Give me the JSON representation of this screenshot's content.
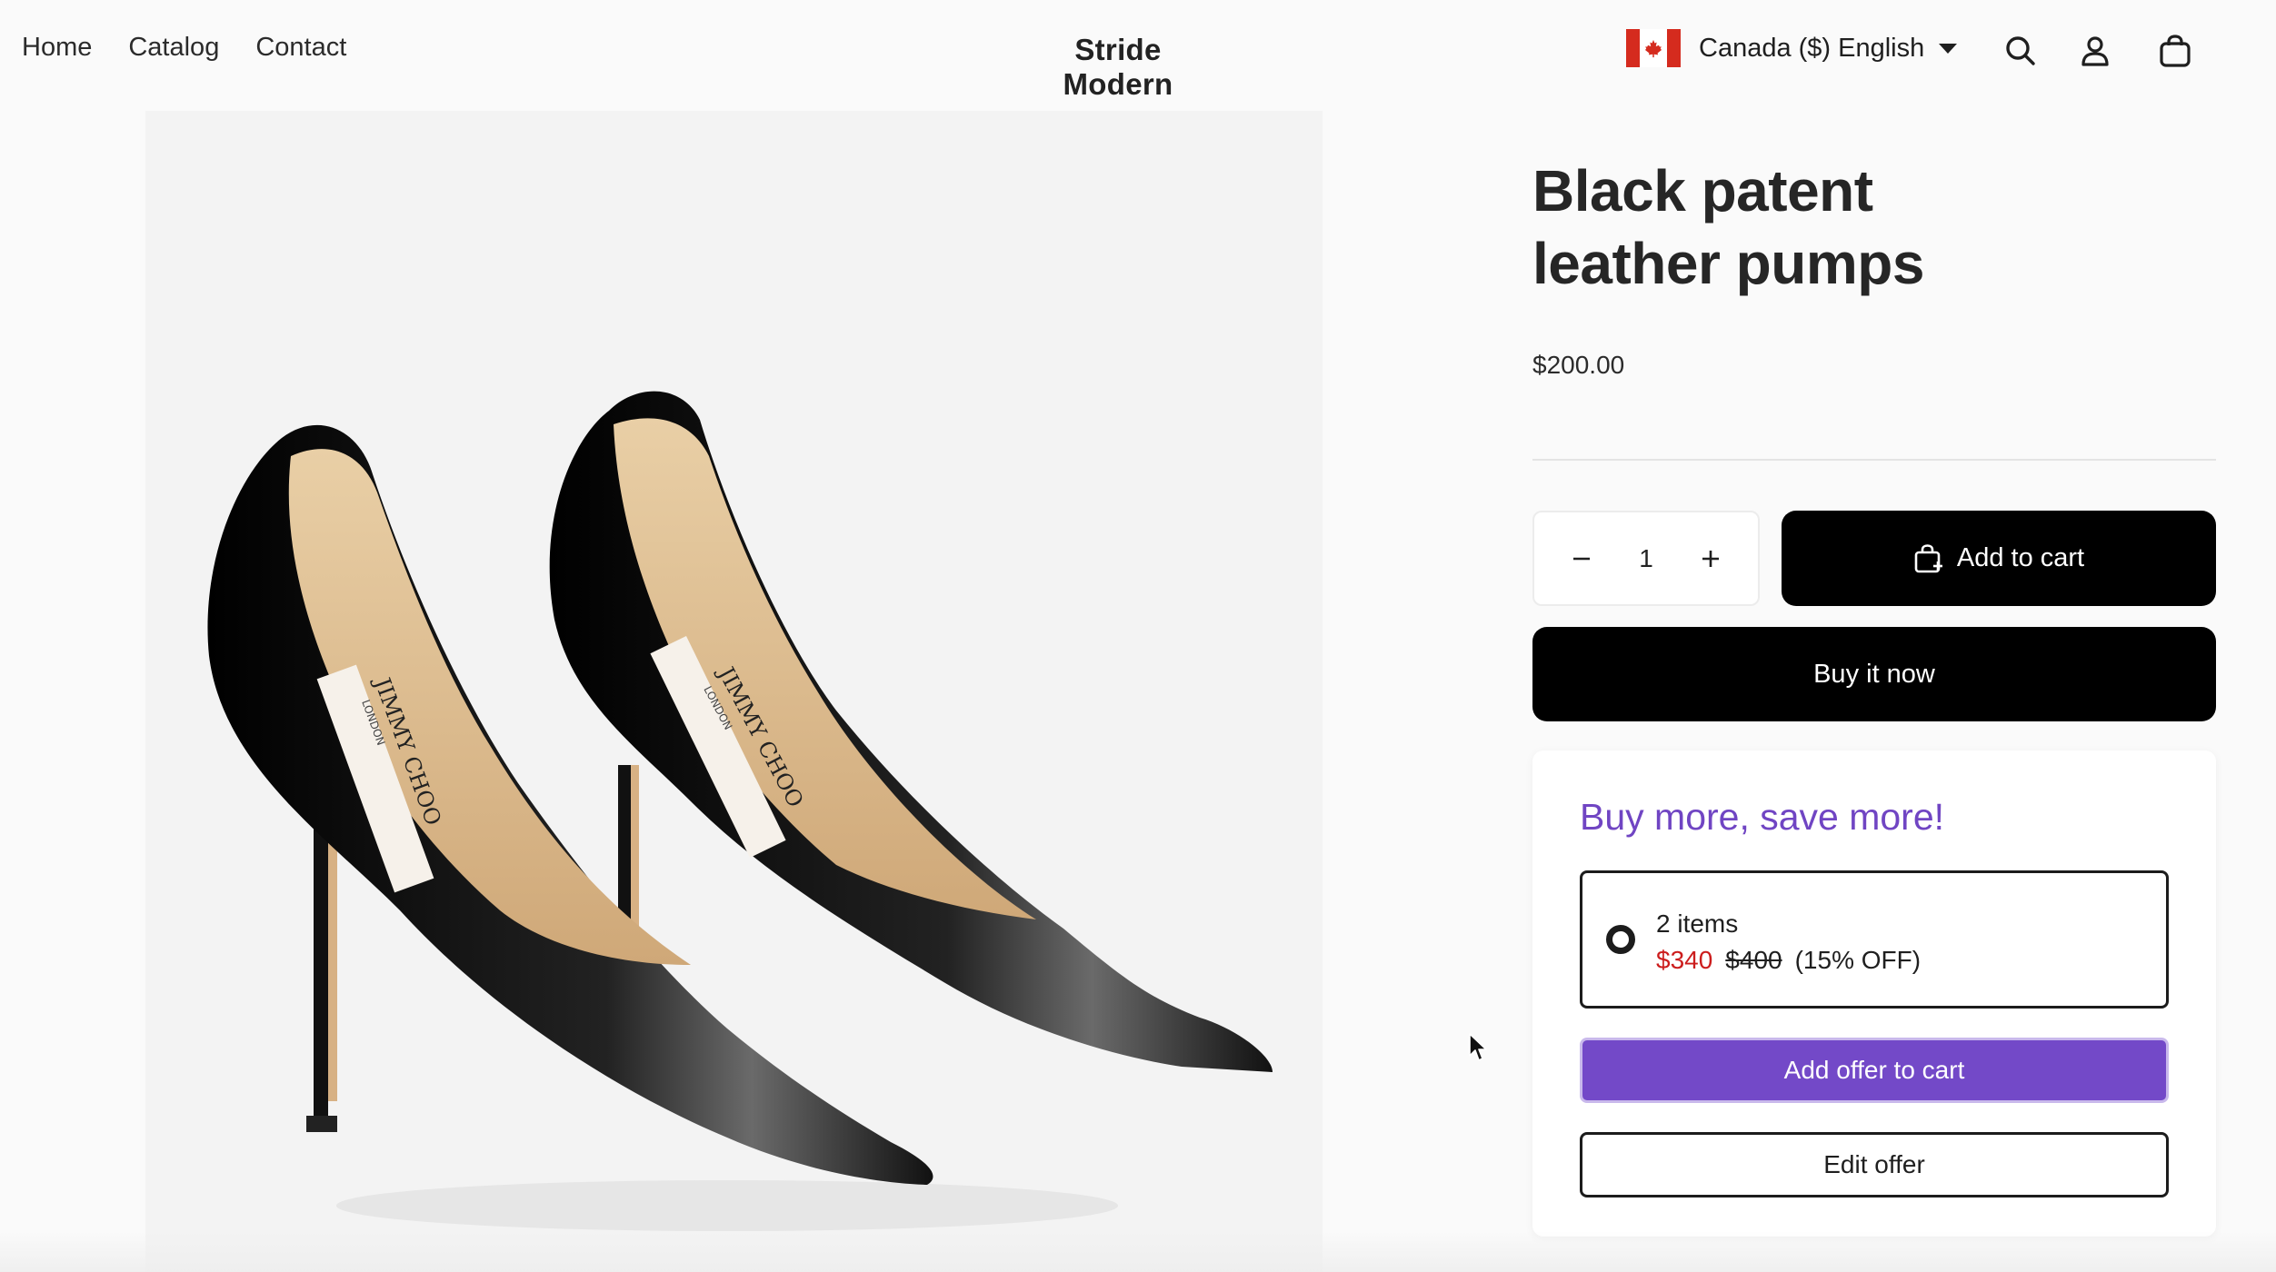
{
  "header": {
    "nav": [
      "Home",
      "Catalog",
      "Contact"
    ],
    "brand": "Stride Modern",
    "locale": "Canada ($) English",
    "icons": [
      "canada-flag-icon",
      "search-icon",
      "account-icon",
      "cart-bag-icon"
    ]
  },
  "product": {
    "title": "Black patent leather pumps",
    "price": "$200.00",
    "quantity": "1",
    "add_to_cart": "Add to cart",
    "buy_now": "Buy it now",
    "image_labels": [
      "JIMMY CHOO",
      "LONDON"
    ]
  },
  "offer": {
    "title": "Buy more, save more!",
    "option": {
      "qty_label": "2 items",
      "sale_price": "$340",
      "original_price": "$400",
      "discount": "(15% OFF)"
    },
    "add_label": "Add offer to cart",
    "edit_label": "Edit offer"
  },
  "colors": {
    "accent_purple": "#7349c8",
    "sale_red": "#cc1d1d",
    "button_black": "#000000"
  }
}
